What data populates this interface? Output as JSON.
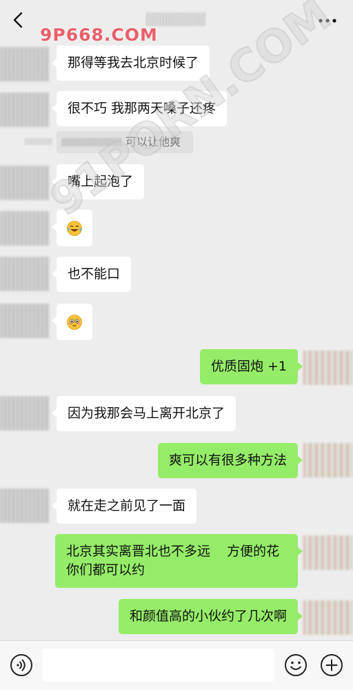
{
  "header": {
    "watermark": "9P668.COM",
    "diagonal_watermark": "91PORN.COM"
  },
  "messages": [
    {
      "side": "left",
      "text": "那得等我去北京时候了"
    },
    {
      "side": "left",
      "text": "很不巧 我那两天嗓子还疼"
    },
    {
      "type": "quote",
      "text": "可以让他爽"
    },
    {
      "side": "left",
      "text": "嘴上起泡了"
    },
    {
      "side": "left",
      "emoji": "joy-tears-emoji"
    },
    {
      "side": "left",
      "text": "也不能口"
    },
    {
      "side": "left",
      "emoji": "flushed-emoji"
    },
    {
      "side": "right",
      "text": "优质固炮 +1"
    },
    {
      "side": "left",
      "text": "因为我那会马上离开北京了"
    },
    {
      "side": "right",
      "text": "爽可以有很多种方法"
    },
    {
      "side": "left",
      "text": "就在走之前见了一面"
    },
    {
      "side": "right",
      "text": "北京其实离晋北也不多远    方便的花你们都可以约"
    },
    {
      "side": "right",
      "text": "和颜值高的小伙约了几次啊"
    }
  ],
  "input": {
    "value": "",
    "placeholder": ""
  },
  "icons": {
    "back": "chevron-left-icon",
    "more": "more-dots-icon",
    "voice": "voice-icon",
    "emoji": "smiley-icon",
    "plus": "plus-circle-icon"
  },
  "colors": {
    "background": "#ededed",
    "incoming_bubble": "#ffffff",
    "outgoing_bubble": "#95ec69",
    "watermark": "#e8606a"
  }
}
